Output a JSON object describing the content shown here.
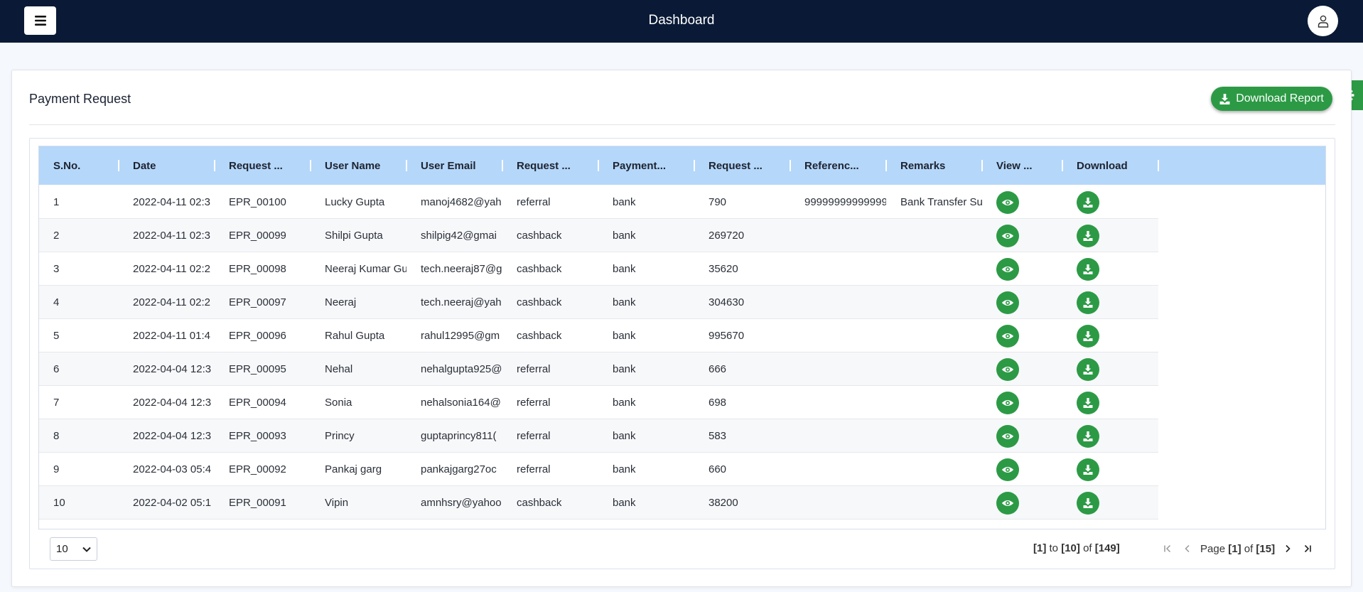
{
  "topbar": {
    "title": "Dashboard"
  },
  "card": {
    "title": "Payment Request",
    "download_report_label": "Download Report"
  },
  "table": {
    "columns": [
      "S.No.",
      "Date",
      "Request ...",
      "User Name",
      "User Email",
      "Request ...",
      "Payment...",
      "Request ...",
      "Referenc...",
      "Remarks",
      "View ...",
      "Download"
    ],
    "rows": [
      {
        "sno": "1",
        "date": "2022-04-11 02:3",
        "request_id": "EPR_00100",
        "user_name": "Lucky Gupta",
        "user_email": "manoj4682@yah",
        "request_type": "referral",
        "payment_mode": "bank",
        "request_amount": "790",
        "reference": "99999999999999",
        "remarks": "Bank Transfer Su"
      },
      {
        "sno": "2",
        "date": "2022-04-11 02:3",
        "request_id": "EPR_00099",
        "user_name": "Shilpi Gupta",
        "user_email": "shilpig42@gmai",
        "request_type": "cashback",
        "payment_mode": "bank",
        "request_amount": "269720",
        "reference": "",
        "remarks": ""
      },
      {
        "sno": "3",
        "date": "2022-04-11 02:2",
        "request_id": "EPR_00098",
        "user_name": "Neeraj Kumar Gu",
        "user_email": "tech.neeraj87@g",
        "request_type": "cashback",
        "payment_mode": "bank",
        "request_amount": "35620",
        "reference": "",
        "remarks": ""
      },
      {
        "sno": "4",
        "date": "2022-04-11 02:2",
        "request_id": "EPR_00097",
        "user_name": "Neeraj",
        "user_email": "tech.neeraj@yah",
        "request_type": "cashback",
        "payment_mode": "bank",
        "request_amount": "304630",
        "reference": "",
        "remarks": ""
      },
      {
        "sno": "5",
        "date": "2022-04-11 01:4",
        "request_id": "EPR_00096",
        "user_name": "Rahul Gupta",
        "user_email": "rahul12995@gm",
        "request_type": "cashback",
        "payment_mode": "bank",
        "request_amount": "995670",
        "reference": "",
        "remarks": ""
      },
      {
        "sno": "6",
        "date": "2022-04-04 12:3",
        "request_id": "EPR_00095",
        "user_name": "Nehal",
        "user_email": "nehalgupta925@",
        "request_type": "referral",
        "payment_mode": "bank",
        "request_amount": "666",
        "reference": "",
        "remarks": ""
      },
      {
        "sno": "7",
        "date": "2022-04-04 12:3",
        "request_id": "EPR_00094",
        "user_name": "Sonia",
        "user_email": "nehalsonia164@",
        "request_type": "referral",
        "payment_mode": "bank",
        "request_amount": "698",
        "reference": "",
        "remarks": ""
      },
      {
        "sno": "8",
        "date": "2022-04-04 12:3",
        "request_id": "EPR_00093",
        "user_name": "Princy",
        "user_email": "guptaprincy811(",
        "request_type": "referral",
        "payment_mode": "bank",
        "request_amount": "583",
        "reference": "",
        "remarks": ""
      },
      {
        "sno": "9",
        "date": "2022-04-03 05:4",
        "request_id": "EPR_00092",
        "user_name": "Pankaj garg",
        "user_email": "pankajgarg27oc",
        "request_type": "referral",
        "payment_mode": "bank",
        "request_amount": "660",
        "reference": "",
        "remarks": ""
      },
      {
        "sno": "10",
        "date": "2022-04-02 05:1",
        "request_id": "EPR_00091",
        "user_name": "Vipin",
        "user_email": "amnhsry@yahoo",
        "request_type": "cashback",
        "payment_mode": "bank",
        "request_amount": "38200",
        "reference": "",
        "remarks": ""
      }
    ]
  },
  "pagination": {
    "page_size": "10",
    "from": "1",
    "to": "10",
    "total": "149",
    "to_word": "to",
    "of_word": "of",
    "page_word": "Page",
    "page": "1",
    "page_count": "15"
  },
  "colors": {
    "topbar": "#0a1a36",
    "header": "#b5d7fa",
    "accent_green": "#2c9a45"
  },
  "icons": {
    "menu": "hamburger-icon",
    "user": "user-icon",
    "gear": "gear-icon",
    "download": "download-icon",
    "view": "eye-icon"
  }
}
